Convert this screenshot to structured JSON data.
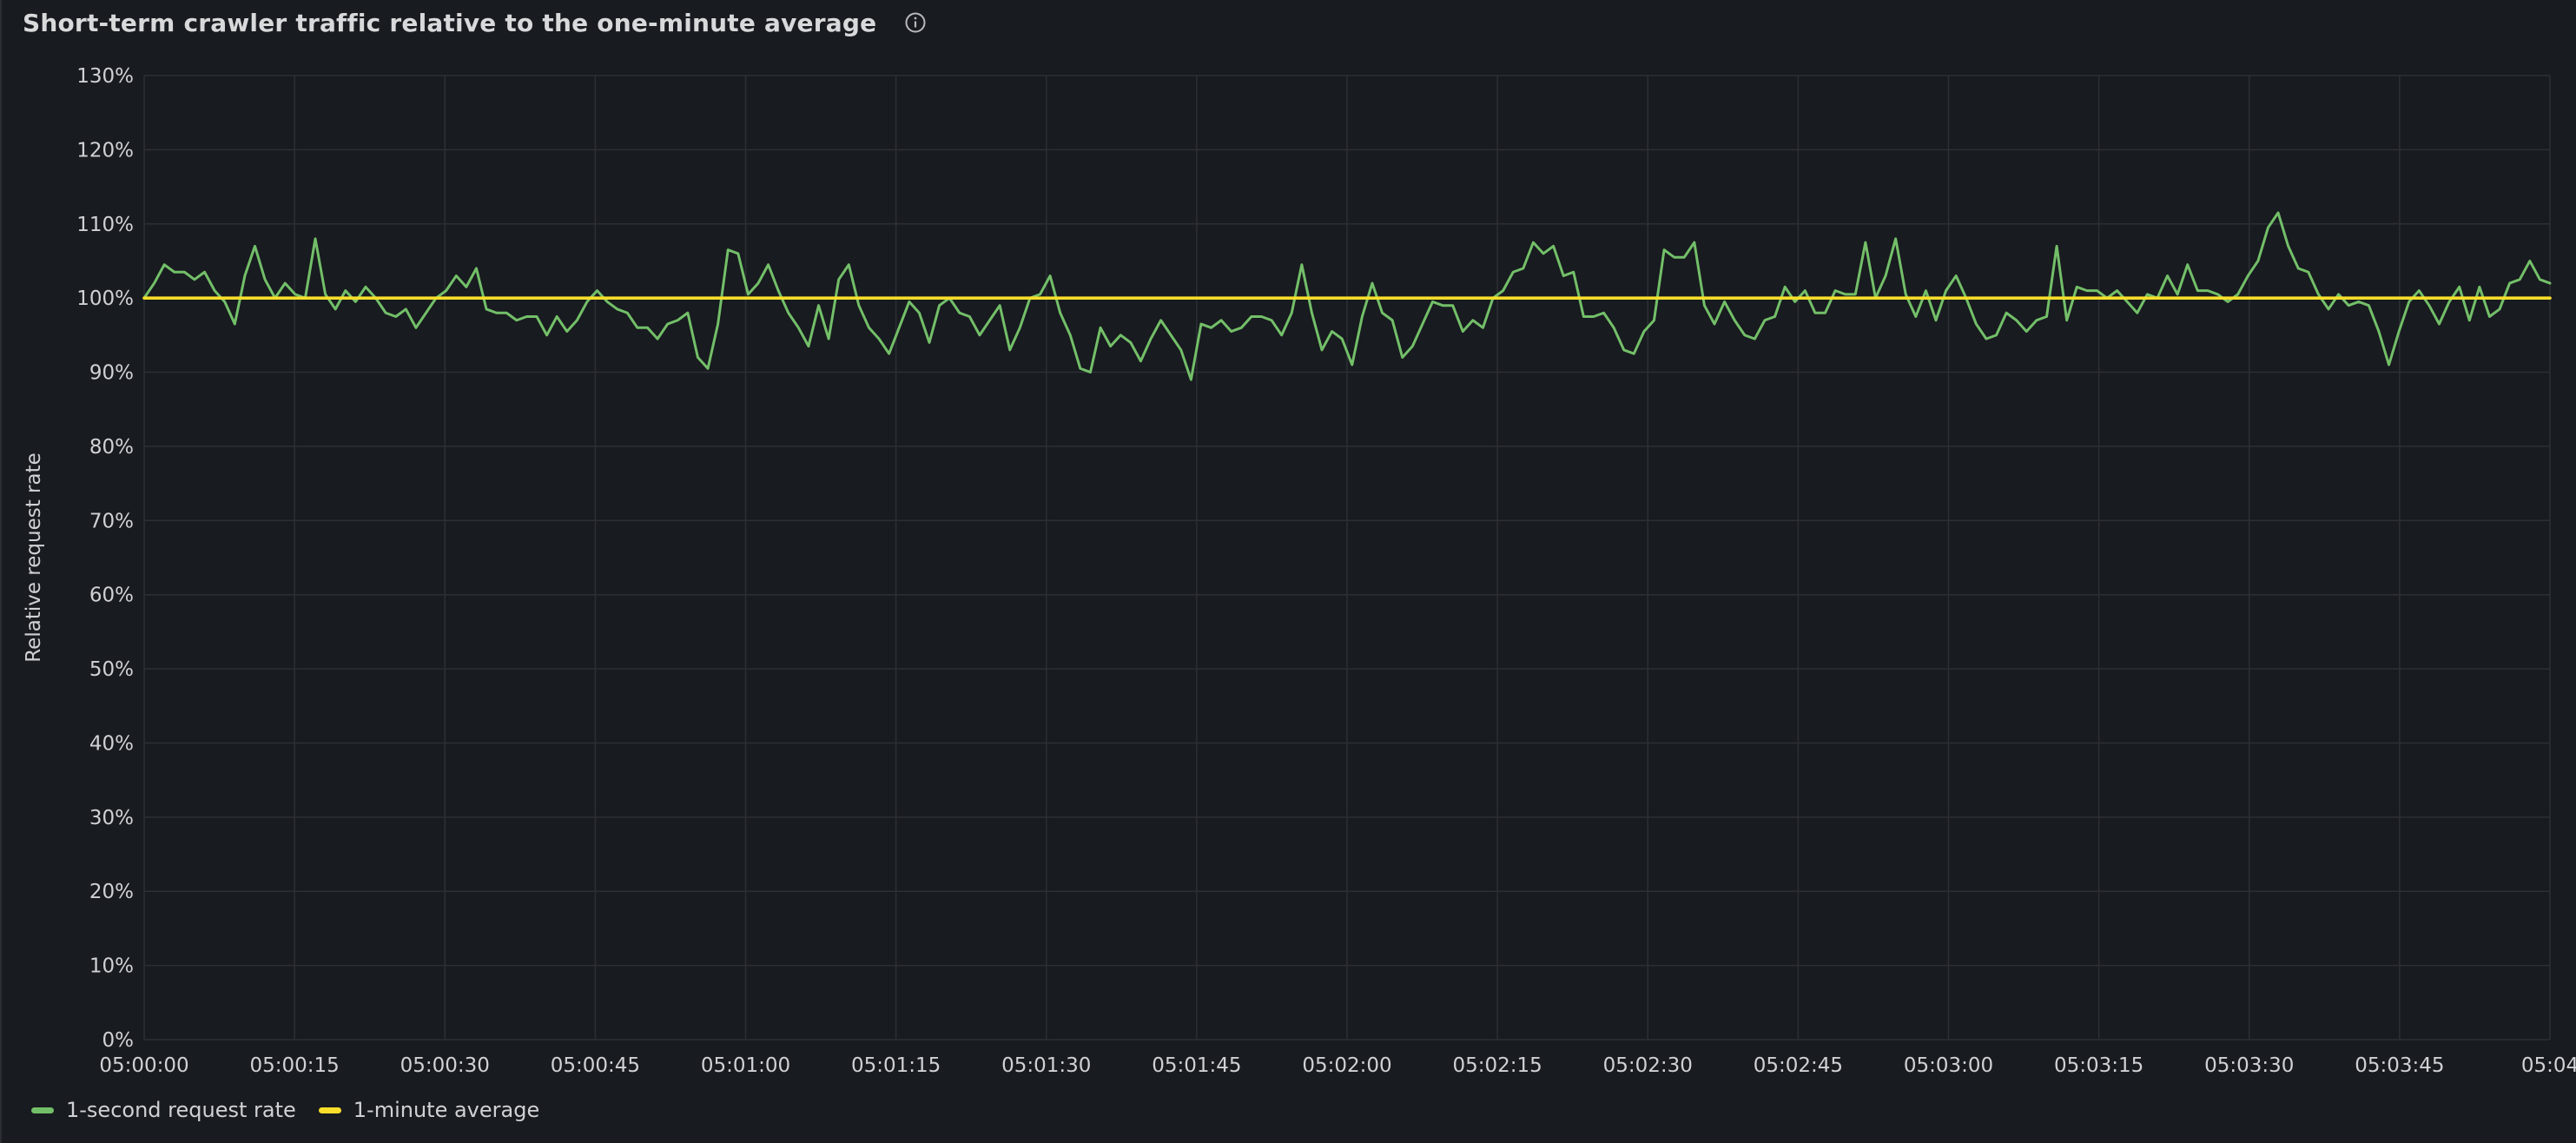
{
  "panel": {
    "title": "Short-term crawler traffic relative to the one-minute average"
  },
  "chart_data": {
    "type": "line",
    "title": "Short-term crawler traffic relative to the one-minute average",
    "ylabel": "Relative request rate",
    "xlabel": "",
    "ylim": [
      0,
      130
    ],
    "xlim_seconds": [
      0,
      240
    ],
    "grid": true,
    "legend_placement": "bottom-left",
    "y_ticks": [
      "0%",
      "10%",
      "20%",
      "30%",
      "40%",
      "50%",
      "60%",
      "70%",
      "80%",
      "90%",
      "100%",
      "110%",
      "120%",
      "130%"
    ],
    "x_ticks": [
      "05:00:00",
      "05:00:15",
      "05:00:30",
      "05:00:45",
      "05:01:00",
      "05:01:15",
      "05:01:30",
      "05:01:45",
      "05:02:00",
      "05:02:15",
      "05:02:30",
      "05:02:45",
      "05:03:00",
      "05:03:15",
      "05:03:30",
      "05:03:45",
      "05:04"
    ],
    "series": [
      {
        "name": "1-second request rate",
        "color": "#73bf69",
        "values": [
          100,
          102,
          104.5,
          103.5,
          103.5,
          102.5,
          103.5,
          101,
          99.5,
          96.5,
          103,
          107,
          102.5,
          100,
          102,
          100.5,
          100,
          108,
          100.5,
          98.5,
          101,
          99.5,
          101.5,
          100,
          98,
          97.5,
          98.5,
          96,
          98,
          100,
          101,
          103,
          101.5,
          104,
          98.5,
          98,
          98,
          97,
          97.5,
          97.5,
          95,
          97.5,
          95.5,
          97,
          99.5,
          101,
          99.5,
          98.5,
          98,
          96,
          96,
          94.5,
          96.5,
          97,
          98,
          92,
          90.5,
          96.5,
          106.5,
          106,
          100.5,
          102,
          104.5,
          101,
          98,
          96,
          93.5,
          99,
          94.5,
          102.5,
          104.5,
          99,
          96,
          94.5,
          92.5,
          96,
          99.5,
          98,
          94,
          99,
          100,
          98,
          97.5,
          95,
          97,
          99,
          93,
          96,
          100,
          100.5,
          103,
          98,
          95,
          90.5,
          90,
          96,
          93.5,
          95,
          94,
          91.5,
          94.5,
          97,
          95,
          93,
          89,
          96.5,
          96,
          97,
          95.5,
          96,
          97.5,
          97.5,
          97,
          95,
          98,
          104.5,
          98,
          93,
          95.5,
          94.5,
          91,
          97.5,
          102,
          98,
          97,
          92,
          93.5,
          96.5,
          99.5,
          99,
          99,
          95.5,
          97,
          96,
          100,
          101,
          103.5,
          104,
          107.5,
          106,
          107,
          103,
          103.5,
          97.5,
          97.5,
          98,
          96,
          93,
          92.5,
          95.5,
          97,
          106.5,
          105.5,
          105.5,
          107.5,
          99,
          96.5,
          99.5,
          97,
          95,
          94.5,
          97,
          97.5,
          101.5,
          99.5,
          101,
          98,
          98,
          101,
          100.5,
          100.5,
          107.5,
          100,
          103,
          108,
          100.5,
          97.5,
          101,
          97,
          101,
          103,
          100,
          96.5,
          94.5,
          95,
          98,
          97,
          95.5,
          97,
          97.5,
          107,
          97,
          101.5,
          101,
          101,
          100,
          101,
          99.5,
          98,
          100.5,
          100,
          103,
          100.5,
          104.5,
          101,
          101,
          100.5,
          99.5,
          100.5,
          103,
          105,
          109.5,
          111.5,
          107,
          104,
          103.5,
          100.5,
          98.5,
          100.5,
          99,
          99.5,
          99,
          95.5,
          91,
          95.5,
          99.5,
          101,
          99,
          96.5,
          99.5,
          101.5,
          97,
          101.5,
          97.5,
          98.5,
          102,
          102.5,
          105,
          102.5,
          102
        ]
      },
      {
        "name": "1-minute average",
        "color": "#fade2a",
        "values": [
          100,
          100
        ]
      }
    ]
  }
}
